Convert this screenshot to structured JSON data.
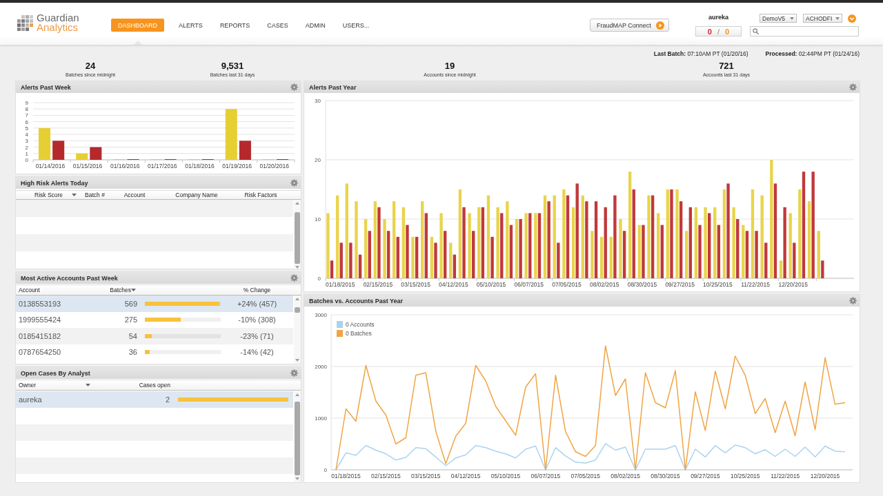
{
  "header": {
    "logo": {
      "line1": "Guardian",
      "line2": "Analytics"
    },
    "nav": [
      {
        "label": "DASHBOARD",
        "selected": true
      },
      {
        "label": "ALERTS",
        "selected": false
      },
      {
        "label": "REPORTS",
        "selected": false
      },
      {
        "label": "CASES",
        "selected": false
      },
      {
        "label": "ADMIN",
        "selected": false
      },
      {
        "label": "USERS...",
        "selected": false
      }
    ],
    "connect_button": {
      "label": "FraudMAP Connect"
    },
    "user": {
      "name": "aureka",
      "counters": [
        {
          "value": "0",
          "color": "#d9232e"
        },
        {
          "value": "0",
          "color": "#f7941d"
        }
      ],
      "separator": "/"
    },
    "dropdowns": [
      {
        "value": "DemoV5"
      },
      {
        "value": "ACHODFI"
      }
    ]
  },
  "status": {
    "last_batch": "**Last Batch:** 07:10AM PT (01/20/16)",
    "processed": "**Processed:** 02:44PM PT (01/24/16)"
  },
  "stats": [
    {
      "value": "24",
      "label": "Batches since midnight"
    },
    {
      "value": "9,531",
      "label": "Batches last 31 days"
    },
    {
      "value": "19",
      "label": "Accounts since midnight"
    },
    {
      "value": "721",
      "label": "Accounts last 31 days"
    }
  ],
  "alerts_past_week": {
    "title": "Alerts Past Week",
    "chart_data": [
      {
        "type": "bar",
        "categories": [
          "01/14/2016",
          "01/15/2016",
          "01/16/2016",
          "01/17/2016",
          "01/18/2016",
          "01/19/2016",
          "01/20/2016"
        ],
        "series": [
          {
            "color": "#e6cf33",
            "values": [
              5,
              1,
              0,
              0,
              0,
              8,
              0
            ]
          },
          {
            "color": "#b5292d",
            "values": [
              3,
              2,
              0,
              0,
              0,
              3,
              0
            ]
          }
        ],
        "ylim": [
          0,
          9
        ],
        "yticks": [
          0,
          1,
          2,
          3,
          4,
          5,
          6,
          7,
          8,
          9
        ],
        "grid": true
      }
    ]
  },
  "high_risk_alerts": {
    "title": "High Risk Alerts Today",
    "columns": [
      {
        "label": "Risk Score",
        "sorted": true
      },
      {
        "label": "Batch #",
        "sorted": false
      },
      {
        "label": "Account",
        "sorted": false
      },
      {
        "label": "Company Name",
        "sorted": false
      },
      {
        "label": "Risk Factors",
        "sorted": false
      }
    ]
  },
  "most_active_accounts": {
    "title": "Most Active Accounts Past Week",
    "columns": [
      {
        "label": "Account",
        "sorted": false
      },
      {
        "label": "Batches",
        "sorted": true
      },
      {
        "label": "% Change",
        "sorted": false
      }
    ],
    "rows": [
      {
        "account": "0138553193",
        "batches": "569",
        "level": 0.98,
        "change": "+24% (457)",
        "selected": true
      },
      {
        "account": "1999555424",
        "batches": "275",
        "level": 0.47,
        "change": "-10% (308)",
        "selected": false
      },
      {
        "account": "0185415182",
        "batches": "54",
        "level": 0.09,
        "change": "-23% (71)",
        "selected": false
      },
      {
        "account": "0787654250",
        "batches": "36",
        "level": 0.06,
        "change": "-14% (42)",
        "selected": false
      }
    ]
  },
  "open_cases": {
    "title": "Open Cases By Analyst",
    "columns": [
      {
        "label": "Owner",
        "sorted": true
      },
      {
        "label": "Cases open",
        "sorted": false
      }
    ],
    "rows": [
      {
        "owner": "aureka",
        "cases": "2",
        "level": 1,
        "selected": true
      }
    ]
  },
  "alerts_past_year": {
    "title": "Alerts Past Year",
    "chart_data": [
      {
        "type": "bar",
        "categories": [
          null,
          "01/18/2015",
          null,
          null,
          null,
          "02/15/2015",
          null,
          null,
          null,
          "03/15/2015",
          null,
          null,
          null,
          "04/12/2015",
          null,
          null,
          null,
          "05/10/2015",
          null,
          null,
          null,
          "06/07/2015",
          null,
          null,
          null,
          "07/05/2015",
          null,
          null,
          null,
          "08/02/2015",
          null,
          null,
          null,
          "08/30/2015",
          null,
          null,
          null,
          "09/27/2015",
          null,
          null,
          null,
          "10/25/2015",
          null,
          null,
          null,
          "11/22/2015",
          null,
          null,
          null,
          "12/20/2015",
          null,
          null,
          null
        ],
        "series": [
          {
            "color": "#e9d44c",
            "values": [
              11,
              14,
              16,
              13,
              10,
              13,
              10,
              13,
              12,
              7,
              13,
              7,
              11,
              6,
              15,
              11,
              12,
              14,
              12,
              13,
              10,
              11,
              11,
              14,
              14,
              15,
              12,
              14,
              8,
              7,
              7,
              10,
              18,
              9,
              14,
              11,
              15,
              15,
              8,
              12,
              12,
              12,
              15,
              12,
              9,
              15,
              14,
              20,
              3,
              11,
              15,
              13,
              8
            ]
          },
          {
            "color": "#c0393c",
            "values": [
              3,
              6,
              6,
              4,
              8,
              12,
              8,
              7,
              9,
              7,
              11,
              6,
              8,
              4,
              12,
              8,
              12,
              7,
              11,
              9,
              10,
              11,
              11,
              13,
              6,
              14,
              16,
              13,
              13,
              12,
              14,
              8,
              15,
              9,
              14,
              9,
              15,
              13,
              12,
              9,
              11,
              9,
              16,
              10,
              8,
              8,
              6,
              16,
              12,
              6,
              18,
              18,
              3
            ]
          }
        ],
        "ylim": [
          0,
          30
        ],
        "yticks": [
          0,
          10,
          20,
          30
        ],
        "grid": true
      }
    ]
  },
  "batches_vs_accounts": {
    "title": "Batches vs. Accounts Past Year",
    "chart_data": [
      {
        "type": "line",
        "categories": [
          null,
          "01/18/2015",
          null,
          null,
          null,
          "02/15/2015",
          null,
          null,
          null,
          "03/15/2015",
          null,
          null,
          null,
          "04/12/2015",
          null,
          null,
          null,
          "05/10/2015",
          null,
          null,
          null,
          "06/07/2015",
          null,
          null,
          null,
          "07/05/2015",
          null,
          null,
          null,
          "08/02/2015",
          null,
          null,
          null,
          "08/30/2015",
          null,
          null,
          null,
          "09/27/2015",
          null,
          null,
          null,
          "10/25/2015",
          null,
          null,
          null,
          "11/22/2015",
          null,
          null,
          null,
          "12/20/2015",
          null,
          null
        ],
        "series": [
          {
            "name": "0 Accounts",
            "color": "#a9d3ef",
            "values": [
              0,
              330,
              280,
              470,
              380,
              310,
              190,
              240,
              430,
              410,
              250,
              80,
              230,
              290,
              470,
              430,
              360,
              310,
              230,
              400,
              460,
              0,
              430,
              270,
              150,
              130,
              190,
              510,
              380,
              440,
              0,
              400,
              400,
              400,
              470,
              0,
              400,
              250,
              470,
              330,
              480,
              430,
              310,
              390,
              260,
              400,
              260,
              440,
              250,
              460,
              360,
              350
            ]
          },
          {
            "name": "0 Batches",
            "color": "#f0a444",
            "values": [
              0,
              1180,
              940,
              2020,
              1330,
              1060,
              500,
              620,
              1830,
              1880,
              750,
              120,
              650,
              900,
              2020,
              1720,
              1230,
              950,
              670,
              1600,
              1860,
              0,
              1830,
              740,
              350,
              260,
              470,
              2400,
              1440,
              1760,
              0,
              1880,
              1300,
              1200,
              1920,
              0,
              1510,
              760,
              1910,
              1180,
              2200,
              1830,
              1090,
              1380,
              720,
              1330,
              660,
              1700,
              780,
              2170,
              1270,
              1300
            ]
          }
        ],
        "ylim": [
          0,
          3000
        ],
        "yticks": [
          0,
          1000,
          2000,
          3000
        ],
        "grid": true,
        "legend": "top-left"
      }
    ]
  }
}
